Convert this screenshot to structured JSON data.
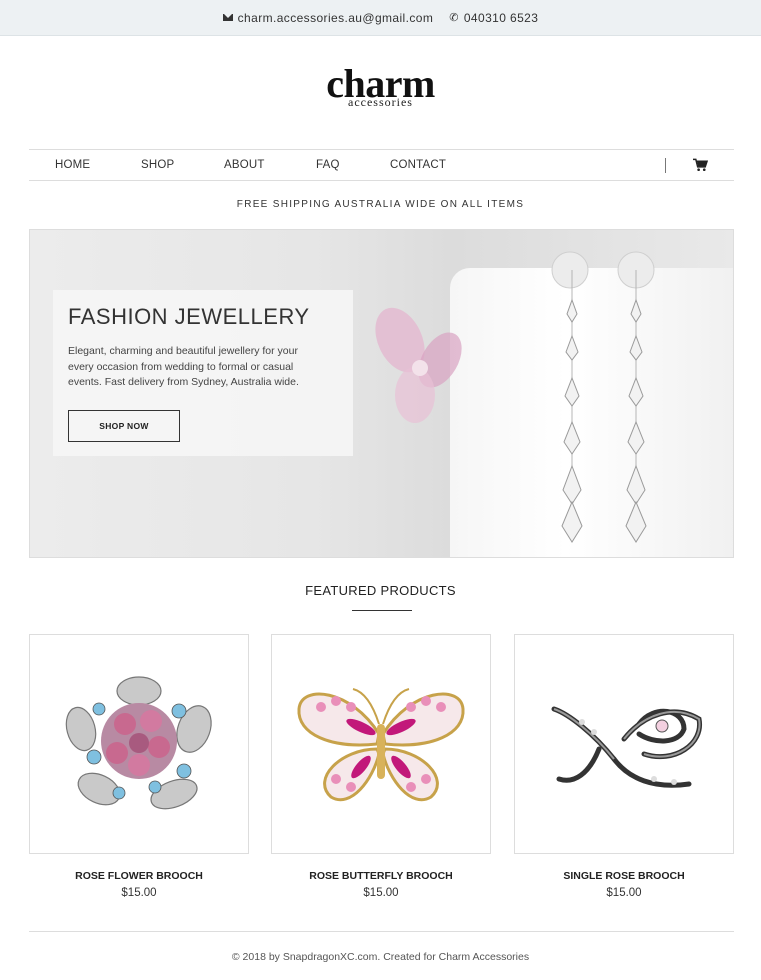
{
  "topbar": {
    "email": "charm.accessories.au@gmail.com",
    "phone": "040310 6523",
    "email_icon": "envelope-icon",
    "phone_icon": "phone-icon"
  },
  "logo": {
    "word": "charm",
    "sub": "accessories"
  },
  "nav": {
    "items": [
      {
        "label": "HOME"
      },
      {
        "label": "SHOP"
      },
      {
        "label": "ABOUT"
      },
      {
        "label": "FAQ"
      },
      {
        "label": "CONTACT"
      }
    ],
    "cart_icon": "cart-icon"
  },
  "shipping": "FREE SHIPPING AUSTRALIA WIDE ON ALL ITEMS",
  "hero": {
    "title": "FASHION JEWELLERY",
    "description": "Elegant, charming and beautiful jewellery for your every occasion from wedding to formal or casual events. Fast delivery from Sydney, Australia wide.",
    "button": "SHOP NOW"
  },
  "featured": {
    "heading": "FEATURED PRODUCTS",
    "products": [
      {
        "name": "ROSE FLOWER BROOCH",
        "price": "$15.00"
      },
      {
        "name": "ROSE BUTTERFLY BROOCH",
        "price": "$15.00"
      },
      {
        "name": "SINGLE ROSE BROOCH",
        "price": "$15.00"
      }
    ]
  },
  "footer": "© 2018 by SnapdragonXC.com. Created for Charm Accessories"
}
